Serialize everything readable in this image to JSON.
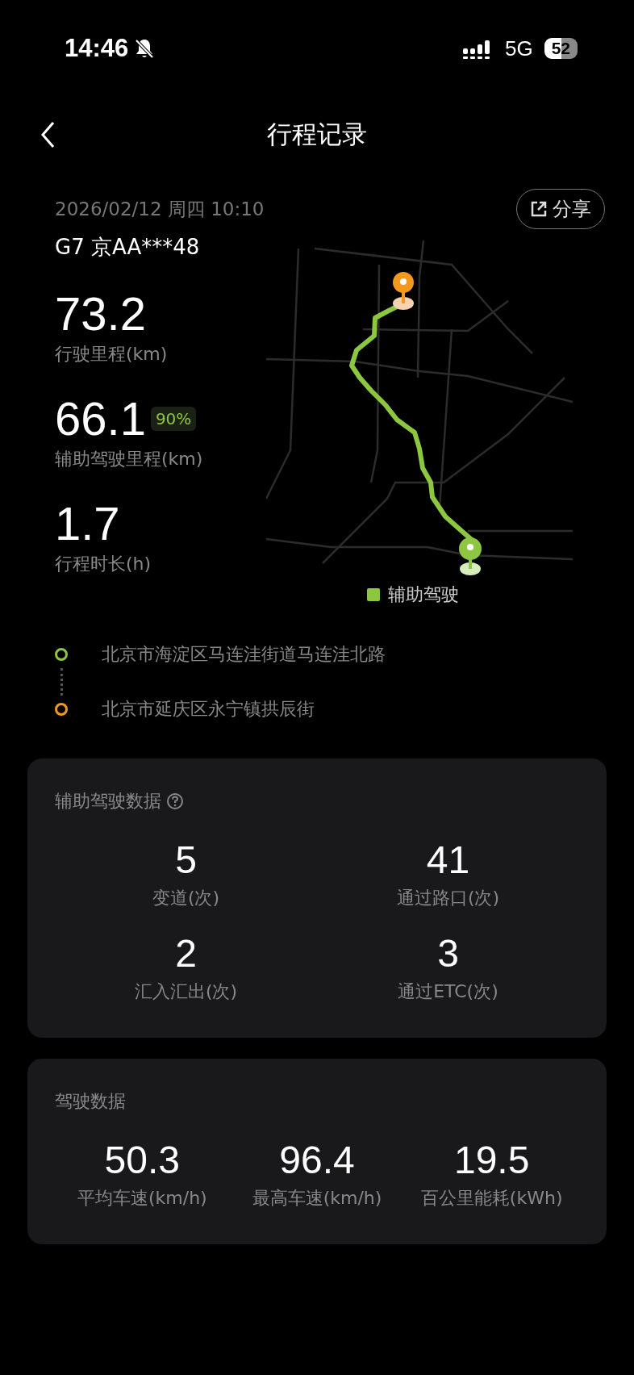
{
  "status_bar": {
    "time": "14:46",
    "network": "5G",
    "battery": "52"
  },
  "header": {
    "title": "行程记录"
  },
  "trip": {
    "date": "2026/02/12 周四 10:10",
    "vehicle": "G7 京AA***48",
    "share": "分享"
  },
  "stats": [
    {
      "value": "73.2",
      "label": "行驶里程(km)"
    },
    {
      "value": "66.1",
      "label": "辅助驾驶里程(km)",
      "badge": "90%"
    },
    {
      "value": "1.7",
      "label": "行程时长(h)"
    }
  ],
  "map": {
    "kind": "picture",
    "legend": "辅助驾驶"
  },
  "route": [
    {
      "address": "北京市海淀区马连洼街道马连洼北路",
      "color": "#8dc63f"
    },
    {
      "address": "北京市延庆区永宁镇拱辰街",
      "color": "#f39a1e"
    }
  ],
  "cards": [
    {
      "title": "辅助驾驶数据",
      "help": true,
      "items": [
        {
          "value": "5",
          "label": "变道(次)"
        },
        {
          "value": "41",
          "label": "通过路口(次)"
        },
        {
          "value": "2",
          "label": "汇入汇出(次)"
        },
        {
          "value": "3",
          "label": "通过ETC(次)"
        }
      ]
    },
    {
      "title": "驾驶数据",
      "help": false,
      "items": [
        {
          "value": "50.3",
          "label": "平均车速(km/h)"
        },
        {
          "value": "96.4",
          "label": "最高车速(km/h)"
        },
        {
          "value": "19.5",
          "label": "百公里能耗(kWh)"
        }
      ]
    }
  ]
}
